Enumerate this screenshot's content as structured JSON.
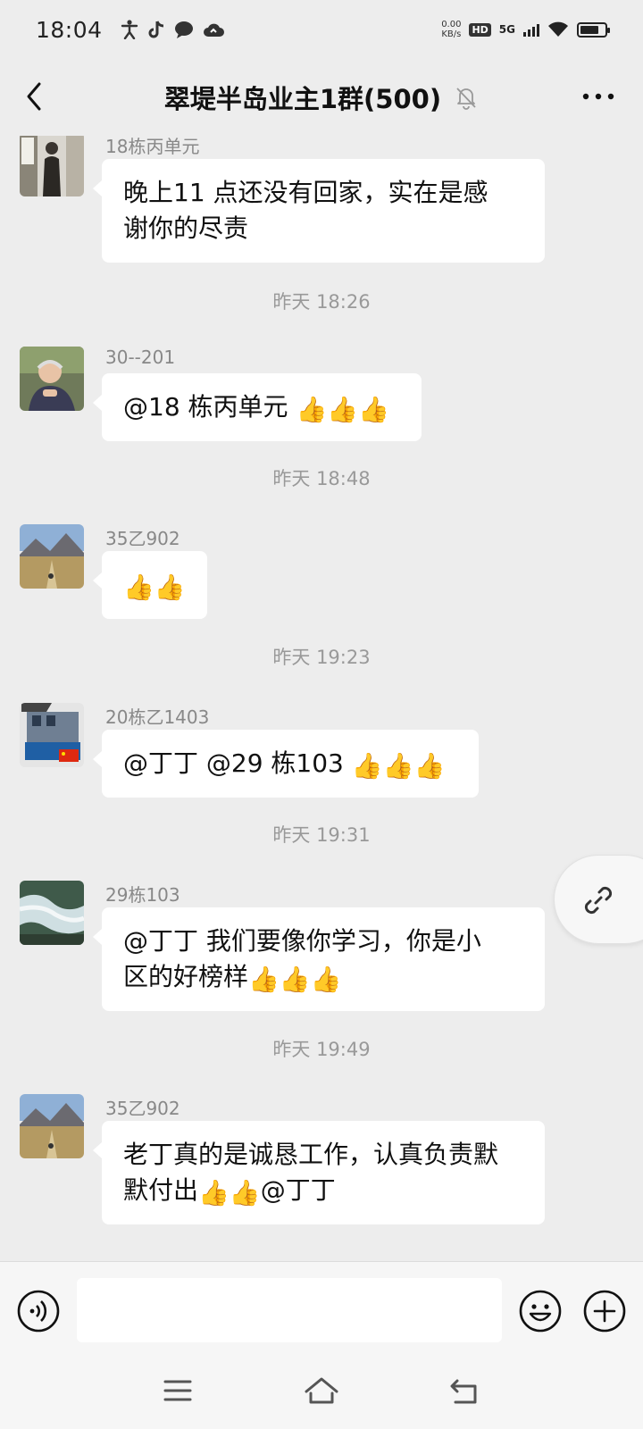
{
  "status": {
    "time": "18:04",
    "net_speed_value": "0.00",
    "net_speed_unit": "KB/s",
    "hd": "HD",
    "network": "5G",
    "icons": [
      "accessibility-icon",
      "tiktok-icon",
      "chat-bubble-icon",
      "cloud-icon"
    ]
  },
  "header": {
    "title": "翠堤半岛业主1群(500)",
    "icons": [
      "back-arrow-icon",
      "mute-bell-icon",
      "more-dots-icon"
    ]
  },
  "messages": [
    {
      "sender": "18栋丙单元",
      "lines": [
        "晚上11 点还没有回家，实在是感",
        "谢你的尽责"
      ]
    },
    {
      "timestamp": "昨天 18:26"
    },
    {
      "sender": "30--201",
      "text": "@18 栋丙单元 ",
      "thumbs": "👍👍👍"
    },
    {
      "timestamp": "昨天 18:48"
    },
    {
      "sender": "35乙902",
      "thumbs": "👍👍"
    },
    {
      "timestamp": "昨天 19:23"
    },
    {
      "sender": "20栋乙1403",
      "text": "@丁丁  @29 栋103 ",
      "thumbs": "👍👍👍"
    },
    {
      "timestamp": "昨天 19:31"
    },
    {
      "sender": "29栋103",
      "line1": "@丁丁  我们要像你学习，你是小",
      "line2": "区的好榜样",
      "thumbs": "👍👍👍"
    },
    {
      "timestamp": "昨天 19:49"
    },
    {
      "sender": "35乙902",
      "line1": "老丁真的是诚恳工作，认真负责默",
      "line2": "默付出",
      "thumbs": "👍👍",
      "line2_tail": "@丁丁"
    }
  ],
  "input": {
    "placeholder": ""
  },
  "colors": {
    "background": "#ededed",
    "bubble": "#ffffff",
    "meta_text": "#888888"
  }
}
